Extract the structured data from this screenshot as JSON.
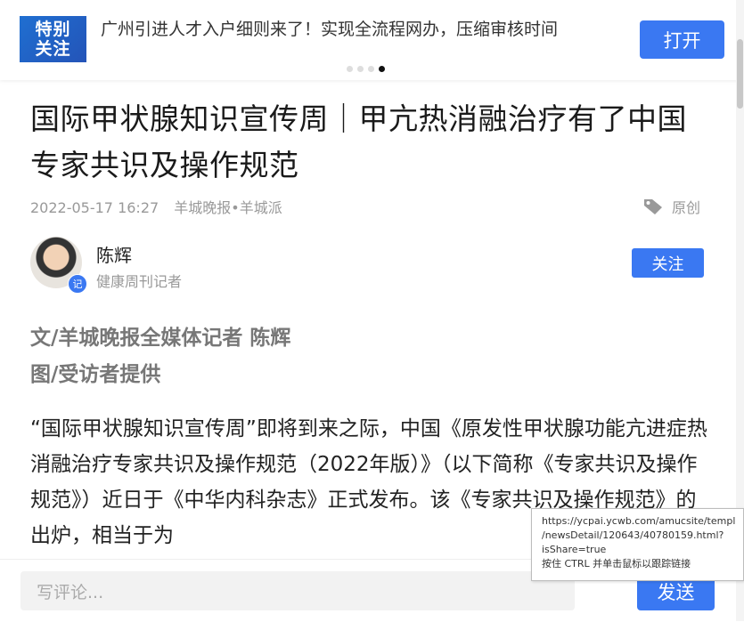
{
  "banner": {
    "badge_line1": "特别",
    "badge_line2": "关注",
    "headline": "广州引进人才入户细则来了！实现全流程网办，压缩审核时间",
    "open_label": "打开",
    "carousel_pages": 4,
    "carousel_active": 4
  },
  "article": {
    "title": "国际甲状腺知识宣传周｜甲亢热消融治疗有了中国专家共识及操作规范",
    "datetime": "2022-05-17 16:27",
    "source": "羊城晚报•羊城派",
    "tag_icon": "tag-icon",
    "tag_label": "原创"
  },
  "author": {
    "name": "陈辉",
    "role": "健康周刊记者",
    "badge": "记",
    "follow_label": "关注"
  },
  "byline": {
    "line1": "文/羊城晚报全媒体记者 陈辉",
    "line2": "图/受访者提供"
  },
  "body": {
    "paragraph1": "“国际甲状腺知识宣传周”即将到来之际，中国《原发性甲状腺功能亢进症热消融治疗专家共识及操作规范（2022年版）》（以下简称《专家共识及操作规范》）近日于《中华内科杂志》正式发布。该《专家共识及操作规范》的出炉，相当于为"
  },
  "comment": {
    "placeholder": "写评论...",
    "send_label": "发送"
  },
  "link_tooltip": {
    "line1": "https://ycpai.ycwb.com/amucsite/templ",
    "line2": "/newsDetail/120643/40780159.html?",
    "line3": "isShare=true",
    "line4": "按住 CTRL 并单击鼠标以跟踪链接"
  },
  "colors": {
    "accent": "#3a78f2",
    "badge_blue": "#1f6fd1",
    "meta_gray": "#999999"
  }
}
